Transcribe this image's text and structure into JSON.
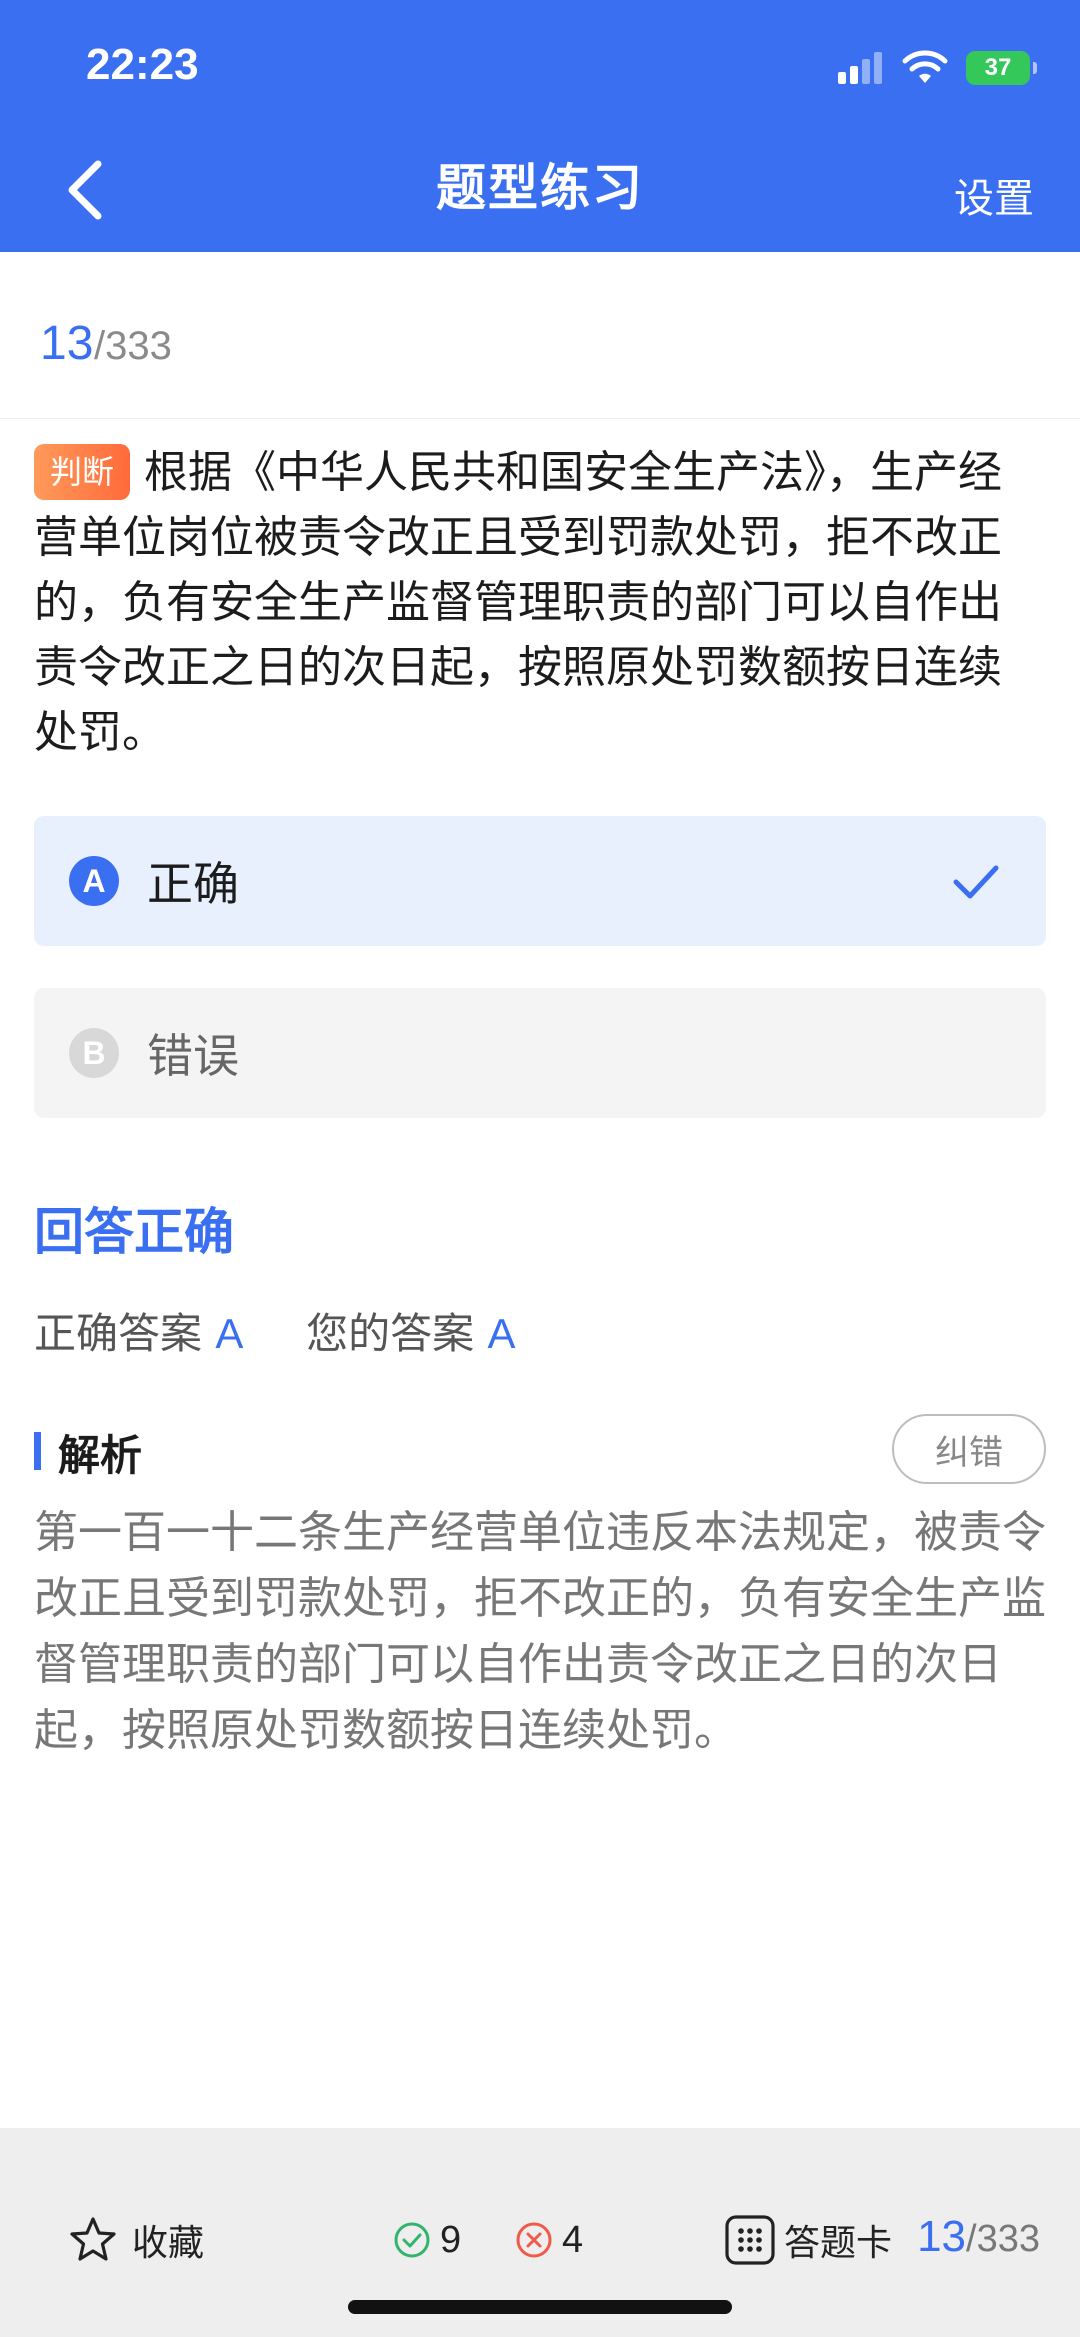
{
  "status_bar": {
    "time": "22:23",
    "battery": "37"
  },
  "nav": {
    "title": "题型练习",
    "settings": "设置"
  },
  "progress": {
    "current": "13",
    "total": "/333"
  },
  "question": {
    "type_badge": "判断",
    "text": "根据《中华人民共和国安全生产法》，生产经营单位岗位被责令改正且受到罚款处罚，拒不改正的，负有安全生产监督管理职责的部门可以自作出责令改正之日的次日起，按照原处罚数额按日连续处罚。"
  },
  "options": [
    {
      "letter": "A",
      "text": "正确"
    },
    {
      "letter": "B",
      "text": "错误"
    }
  ],
  "result": {
    "title": "回答正确",
    "correct_label": "正确答案",
    "correct_value": "A",
    "yours_label": "您的答案",
    "yours_value": "A"
  },
  "analysis": {
    "title": "解析",
    "report_button": "纠错",
    "text": "第一百一十二条生产经营单位违反本法规定，被责令改正且受到罚款处罚，拒不改正的，负有安全生产监督管理职责的部门可以自作出责令改正之日的次日起，按照原处罚数额按日连续处罚。"
  },
  "bottom_bar": {
    "favorite": "收藏",
    "right_count": "9",
    "wrong_count": "4",
    "answer_card": "答题卡",
    "progress_current": "13",
    "progress_total": "/333"
  },
  "colors": {
    "accent": "#3a6ff2",
    "badge": "#ff7a45",
    "correct": "#34b36a",
    "wrong": "#f05a46"
  }
}
